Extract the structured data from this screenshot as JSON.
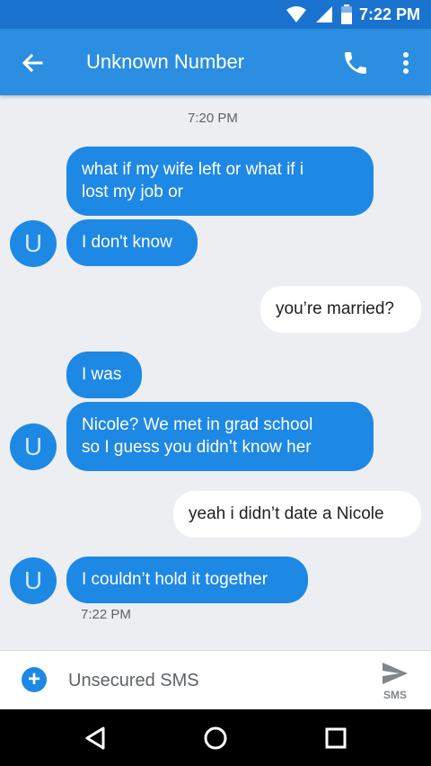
{
  "status_bar": {
    "time": "7:22 PM"
  },
  "header": {
    "title": "Unknown Number",
    "back_icon": "arrow-back-icon",
    "call_icon": "phone-icon",
    "more_icon": "more-vert-icon"
  },
  "conversation": {
    "timestamp_top": "7:20 PM",
    "messages": [
      {
        "direction": "incoming",
        "text": "what if my wife left or what if i\nlost my job or"
      },
      {
        "direction": "incoming",
        "text": "I don't know"
      },
      {
        "direction": "outgoing",
        "text": "you’re married?"
      },
      {
        "direction": "incoming",
        "text": "I was"
      },
      {
        "direction": "incoming",
        "text": "Nicole? We met in grad school\nso I guess you didn’t know her"
      },
      {
        "direction": "outgoing",
        "text": "yeah i didn’t date a Nicole"
      },
      {
        "direction": "incoming",
        "text": "I couldn’t hold it together"
      }
    ],
    "timestamp_bottom": "7:22 PM",
    "avatar_letter": "U"
  },
  "composer": {
    "placeholder": "Unsecured SMS",
    "send_label": "SMS"
  },
  "colors": {
    "status_bar": "#1a73cf",
    "app_bar": "#2b8ee0",
    "incoming_bubble": "#1e88e5",
    "outgoing_bubble": "#ffffff",
    "background": "#eceef1"
  }
}
